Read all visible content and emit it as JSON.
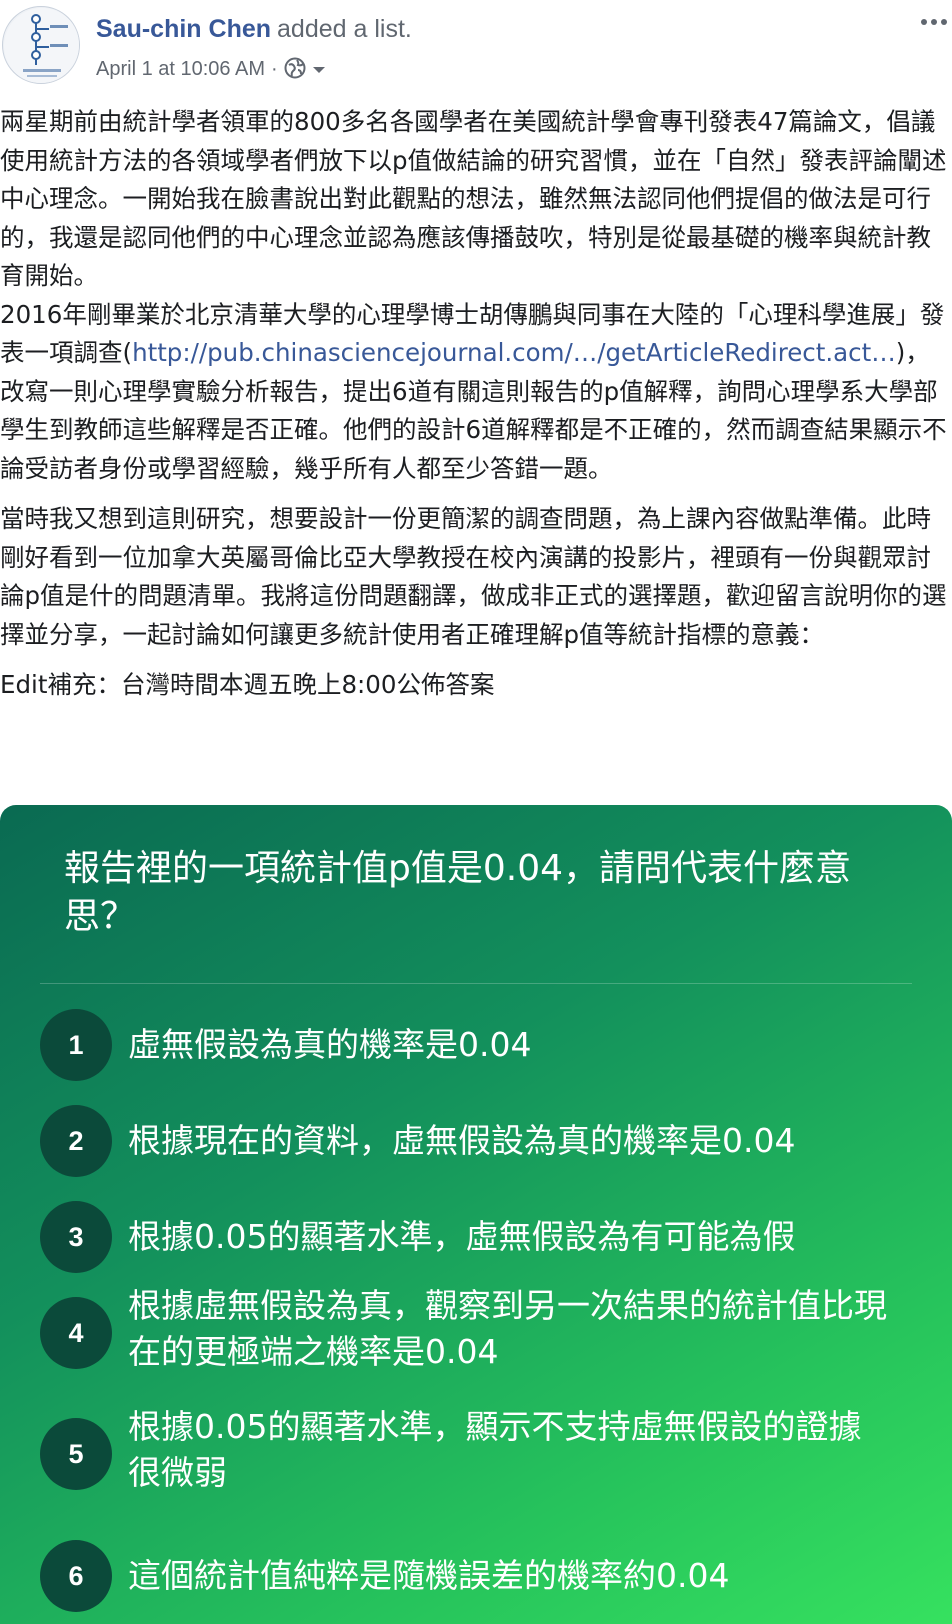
{
  "post": {
    "author_name": "Sau-chin Chen",
    "action": "added a list.",
    "timestamp": "April 1 at 10:06 AM",
    "separator": "·",
    "privacy_icon": "globe-icon",
    "more_icon": "more-horizontal-icon",
    "paragraph_1": "兩星期前由統計學者領軍的800多名各國學者在美國統計學會專刊發表47篇論文，倡議使用統計方法的各領域學者們放下以p值做結論的研究習慣，並在「自然」發表評論闡述中心理念。一開始我在臉書說出對此觀點的想法，雖然無法認同他們提倡的做法是可行的，我還是認同他們的中心理念並認為應該傳播鼓吹，特別是從最基礎的機率與統計教育開始。",
    "paragraph_2_before_link": "2016年剛畢業於北京清華大學的心理學博士胡傳鵬與同事在大陸的「心理科學進展」發表一項調查(",
    "link_text": "http://pub.chinasciencejournal.com/…/getArticleRedirect.act…",
    "paragraph_2_after_link": ")，改寫一則心理學實驗分析報告，提出6道有關這則報告的p值解釋，詢問心理學系大學部學生到教師這些解釋是否正確。他們的設計6道解釋都是不正確的，然而調查結果顯示不論受訪者身份或學習經驗，幾乎所有人都至少答錯一題。",
    "paragraph_3": "當時我又想到這則研究，想要設計一份更簡潔的調查問題，為上課內容做點準備。此時剛好看到一位加拿大英屬哥倫比亞大學教授在校內演講的投影片，裡頭有一份與觀眾討論p值是什的問題清單。我將這份問題翻譯，做成非正式的選擇題，歡迎留言說明你的選擇並分享，一起討論如何讓更多統計使用者正確理解p值等統計指標的意義：",
    "paragraph_4": "Edit補充：台灣時間本週五晚上8:00公佈答案"
  },
  "list_card": {
    "question": "報告裡的一項統計值p值是0.04，請問代表什麼意思？",
    "options": [
      {
        "number": "1",
        "text": "虛無假設為真的機率是0.04"
      },
      {
        "number": "2",
        "text": "根據現在的資料，虛無假設為真的機率是0.04"
      },
      {
        "number": "3",
        "text": "根據0.05的顯著水準，虛無假設為有可能為假"
      },
      {
        "number": "4",
        "text": "根據虛無假設為真，觀察到另一次結果的統計值比現在的更極端之機率是0.04"
      },
      {
        "number": "5",
        "text": "根據0.05的顯著水準，顯示不支持虛無假設的證據很微弱"
      },
      {
        "number": "6",
        "text": "這個統計值純粹是隨機誤差的機率約0.04"
      }
    ],
    "colors": {
      "gradient_start": "#0a6a52",
      "gradient_end": "#36e15f",
      "number_circle": "#0b4a3a",
      "text": "#ffffff"
    }
  },
  "colors": {
    "link": "#385898",
    "meta_text": "#616770",
    "body_text": "#1c1e21"
  }
}
